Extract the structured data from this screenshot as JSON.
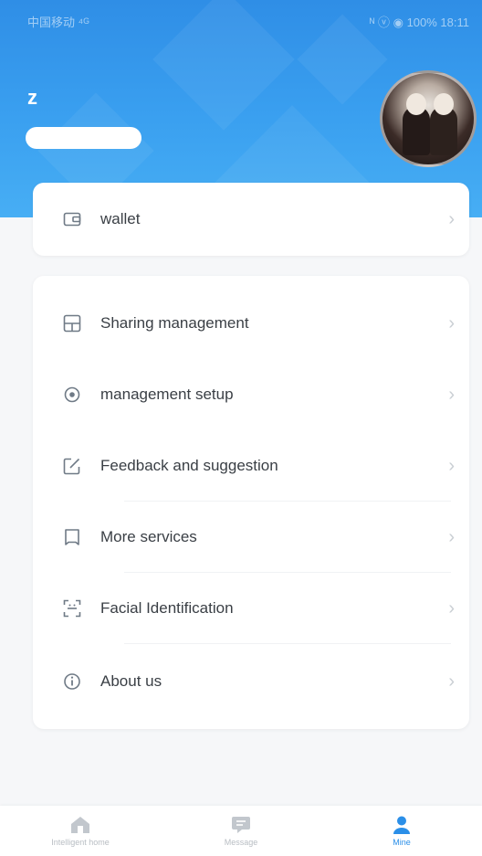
{
  "status_bar": {
    "left": "中国移动 ⁴ᴳ",
    "right": "ᴺ ⓥ ◉ 100% 18:11"
  },
  "profile": {
    "name": "z"
  },
  "wallet": {
    "label": "wallet",
    "icon": "wallet-icon"
  },
  "menu": {
    "items": [
      {
        "label": "Sharing management",
        "icon": "grid-icon"
      },
      {
        "label": "management setup",
        "icon": "target-icon"
      },
      {
        "label": "Feedback and suggestion",
        "icon": "edit-icon"
      },
      {
        "label": "More services",
        "icon": "bookmark-icon"
      },
      {
        "label": "Facial Identification",
        "icon": "face-scan-icon"
      },
      {
        "label": "About us",
        "icon": "info-icon"
      }
    ]
  },
  "bottom_nav": {
    "items": [
      {
        "label": "Intelligent home",
        "icon": "home-icon",
        "active": false
      },
      {
        "label": "Message",
        "icon": "message-icon",
        "active": false
      },
      {
        "label": "Mine",
        "icon": "person-icon",
        "active": true
      }
    ]
  },
  "colors": {
    "accent": "#2b8fe8",
    "header_top": "#2f8ee6",
    "header_bottom": "#47aef4",
    "text": "#3a3f45",
    "muted": "#6f7a86",
    "chevron": "#c9ced3",
    "background": "#f6f7f9"
  },
  "chevron_glyph": "›"
}
